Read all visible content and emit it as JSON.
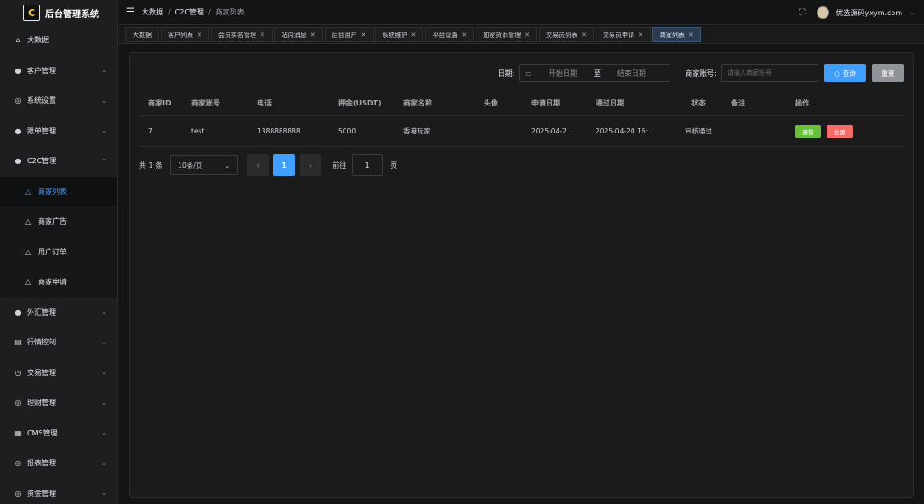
{
  "app": {
    "title": "后台管理系统",
    "logo_glyph": "C"
  },
  "sidebar": {
    "items": [
      {
        "icon": "home-icon",
        "glyph": "⌂",
        "label": "大数据",
        "arrow": ""
      },
      {
        "icon": "customer-icon",
        "glyph": "●",
        "label": "客户管理",
        "arrow": "⌄"
      },
      {
        "icon": "settings-icon",
        "glyph": "◎",
        "label": "系统设置",
        "arrow": "⌄"
      },
      {
        "icon": "copy-trade-icon",
        "glyph": "●",
        "label": "跟单管理",
        "arrow": "⌄"
      },
      {
        "icon": "c2c-icon",
        "glyph": "●",
        "label": "C2C管理",
        "arrow": "⌃"
      }
    ],
    "c2c_children": [
      {
        "glyph": "△",
        "label": "商家列表",
        "active": true
      },
      {
        "glyph": "△",
        "label": "商家广告",
        "active": false
      },
      {
        "glyph": "△",
        "label": "用户订单",
        "active": false
      },
      {
        "glyph": "△",
        "label": "商家申请",
        "active": false
      }
    ],
    "items_after": [
      {
        "icon": "forex-icon",
        "glyph": "●",
        "label": "外汇管理",
        "arrow": "⌄"
      },
      {
        "icon": "market-control-icon",
        "glyph": "▤",
        "label": "行情控制",
        "arrow": "⌄"
      },
      {
        "icon": "trade-icon",
        "glyph": "◷",
        "label": "交易管理",
        "arrow": "⌄"
      },
      {
        "icon": "finance-icon",
        "glyph": "◎",
        "label": "理财管理",
        "arrow": "⌄"
      },
      {
        "icon": "cms-icon",
        "glyph": "▦",
        "label": "CMS管理",
        "arrow": "⌄"
      },
      {
        "icon": "report-icon",
        "glyph": "◎",
        "label": "报表管理",
        "arrow": "⌄"
      },
      {
        "icon": "funds-icon",
        "glyph": "◎",
        "label": "资金管理",
        "arrow": "⌄"
      }
    ]
  },
  "header": {
    "breadcrumb": [
      "大数据",
      "C2C管理",
      "商家列表"
    ],
    "username": "优选源码yxym.com"
  },
  "tags": [
    {
      "label": "大数据",
      "closable": false,
      "active": false
    },
    {
      "label": "客户列表",
      "closable": true,
      "active": false
    },
    {
      "label": "会员实名管理",
      "closable": true,
      "active": false
    },
    {
      "label": "站内消息",
      "closable": true,
      "active": false
    },
    {
      "label": "后台用户",
      "closable": true,
      "active": false
    },
    {
      "label": "系统维护",
      "closable": true,
      "active": false
    },
    {
      "label": "平台设置",
      "closable": true,
      "active": false
    },
    {
      "label": "加密货币管理",
      "closable": true,
      "active": false
    },
    {
      "label": "交易员列表",
      "closable": true,
      "active": false
    },
    {
      "label": "交易员申请",
      "closable": true,
      "active": false
    },
    {
      "label": "商家列表",
      "closable": true,
      "active": true
    }
  ],
  "search": {
    "date_label": "日期:",
    "start_placeholder": "开始日期",
    "range_separator": "至",
    "end_placeholder": "结束日期",
    "account_label": "商家账号:",
    "account_placeholder": "请输入商家账号",
    "query_label": "查询",
    "reset_label": "重置"
  },
  "table": {
    "columns": [
      "商家ID",
      "商家账号",
      "电话",
      "押金(USDT)",
      "商家名称",
      "头像",
      "申请日期",
      "通过日期",
      "状态",
      "备注",
      "操作"
    ],
    "rows": [
      {
        "id": "7",
        "account": "test",
        "phone": "1388888888",
        "deposit": "5000",
        "name": "香港玩家",
        "avatar": "",
        "apply_date": "2025-04-2...",
        "approve_date": "2025-04-20 16:...",
        "status": "审核通过",
        "remark": "",
        "view_label": "查看",
        "kick_label": "拉黑"
      }
    ]
  },
  "pagination": {
    "total_text": "共 1 条",
    "page_size": "10条/页",
    "current_page": "1",
    "goto_label": "前往",
    "goto_value": "1",
    "page_unit": "页"
  },
  "colors": {
    "accent": "#409eff",
    "success": "#67c23a",
    "danger": "#f56c6c",
    "neutral": "#909399"
  }
}
